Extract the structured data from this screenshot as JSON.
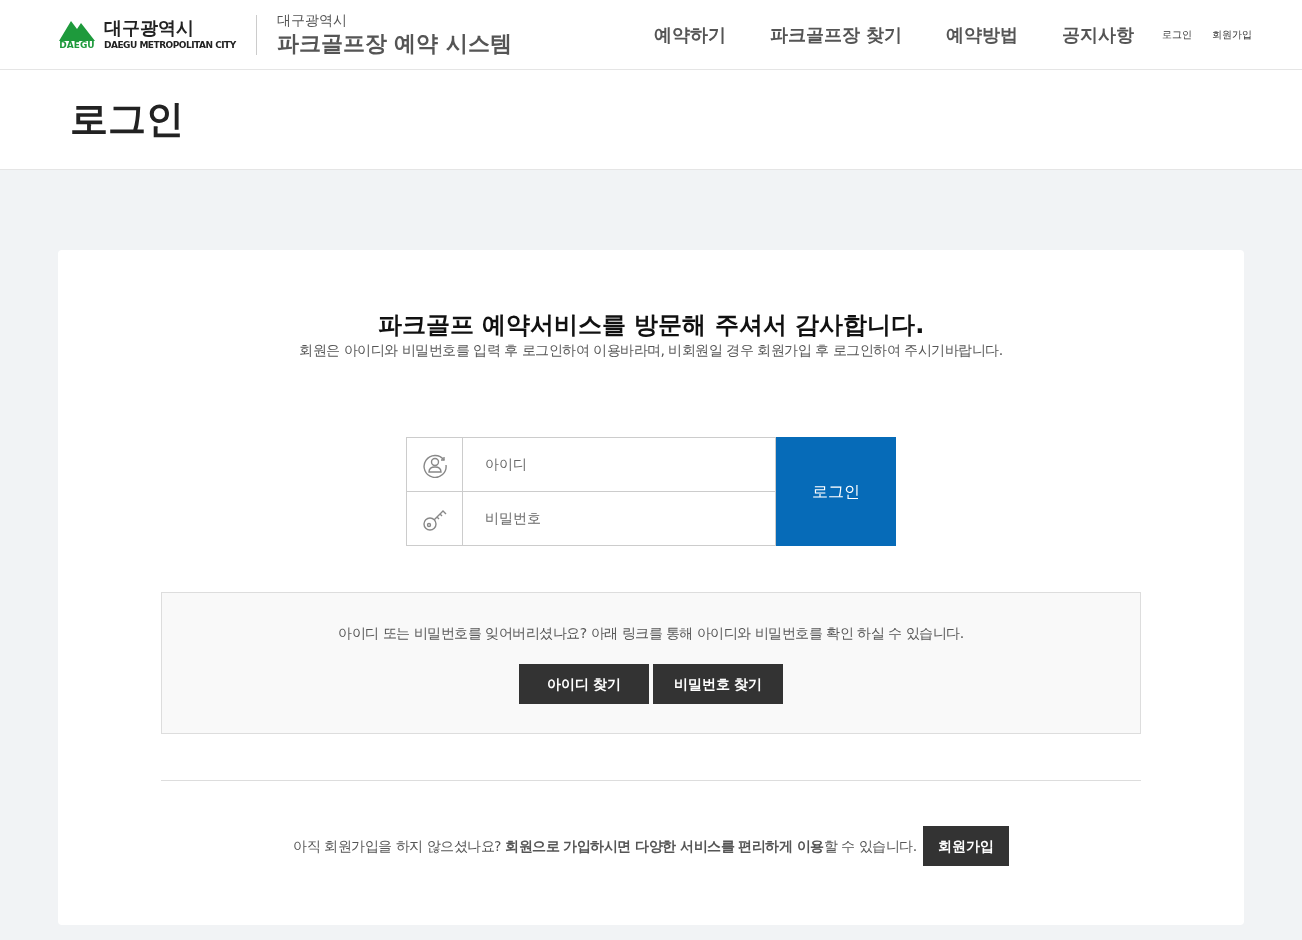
{
  "header": {
    "logo": {
      "name": "대구광역시",
      "subtitle": "DAEGU METROPOLITAN CITY",
      "badge": "DAEGU"
    },
    "site_caption": "대구광역시",
    "site_title": "파크골프장 예약 시스템",
    "nav": [
      {
        "label": "예약하기"
      },
      {
        "label": "파크골프장 찾기"
      },
      {
        "label": "예약방법"
      },
      {
        "label": "공지사항"
      }
    ],
    "utility_links": [
      {
        "label": "로그인"
      },
      {
        "label": "회원가입"
      }
    ]
  },
  "page_title": "로그인",
  "login": {
    "heading": "파크골프 예약서비스를 방문해 주셔서 감사합니다.",
    "intro": "회원은 아이디와 비밀번호를 입력 후 로그인하여 이용바라며, 비회원일 경우 회원가입 후 로그인하여 주시기바랍니다.",
    "fields": [
      {
        "kind": "user",
        "placeholder": "아이디"
      },
      {
        "kind": "password",
        "placeholder": "비밀번호"
      }
    ],
    "submit": "로그인"
  },
  "recovery": {
    "text": "아이디 또는 비밀번호를 잊어버리셨나요? 아래 링크를 통해 아이디와 비밀번호를 확인 하실 수 있습니다.",
    "buttons": [
      "아이디 찾기",
      "비밀번호 찾기"
    ]
  },
  "signup": {
    "text": "아직 회원가입을 하지 않으셨나요? **회원으로 가입하시면 다양한 서비스를 편리하게 이용**할 수 있습니다.",
    "button": "회원가입"
  }
}
